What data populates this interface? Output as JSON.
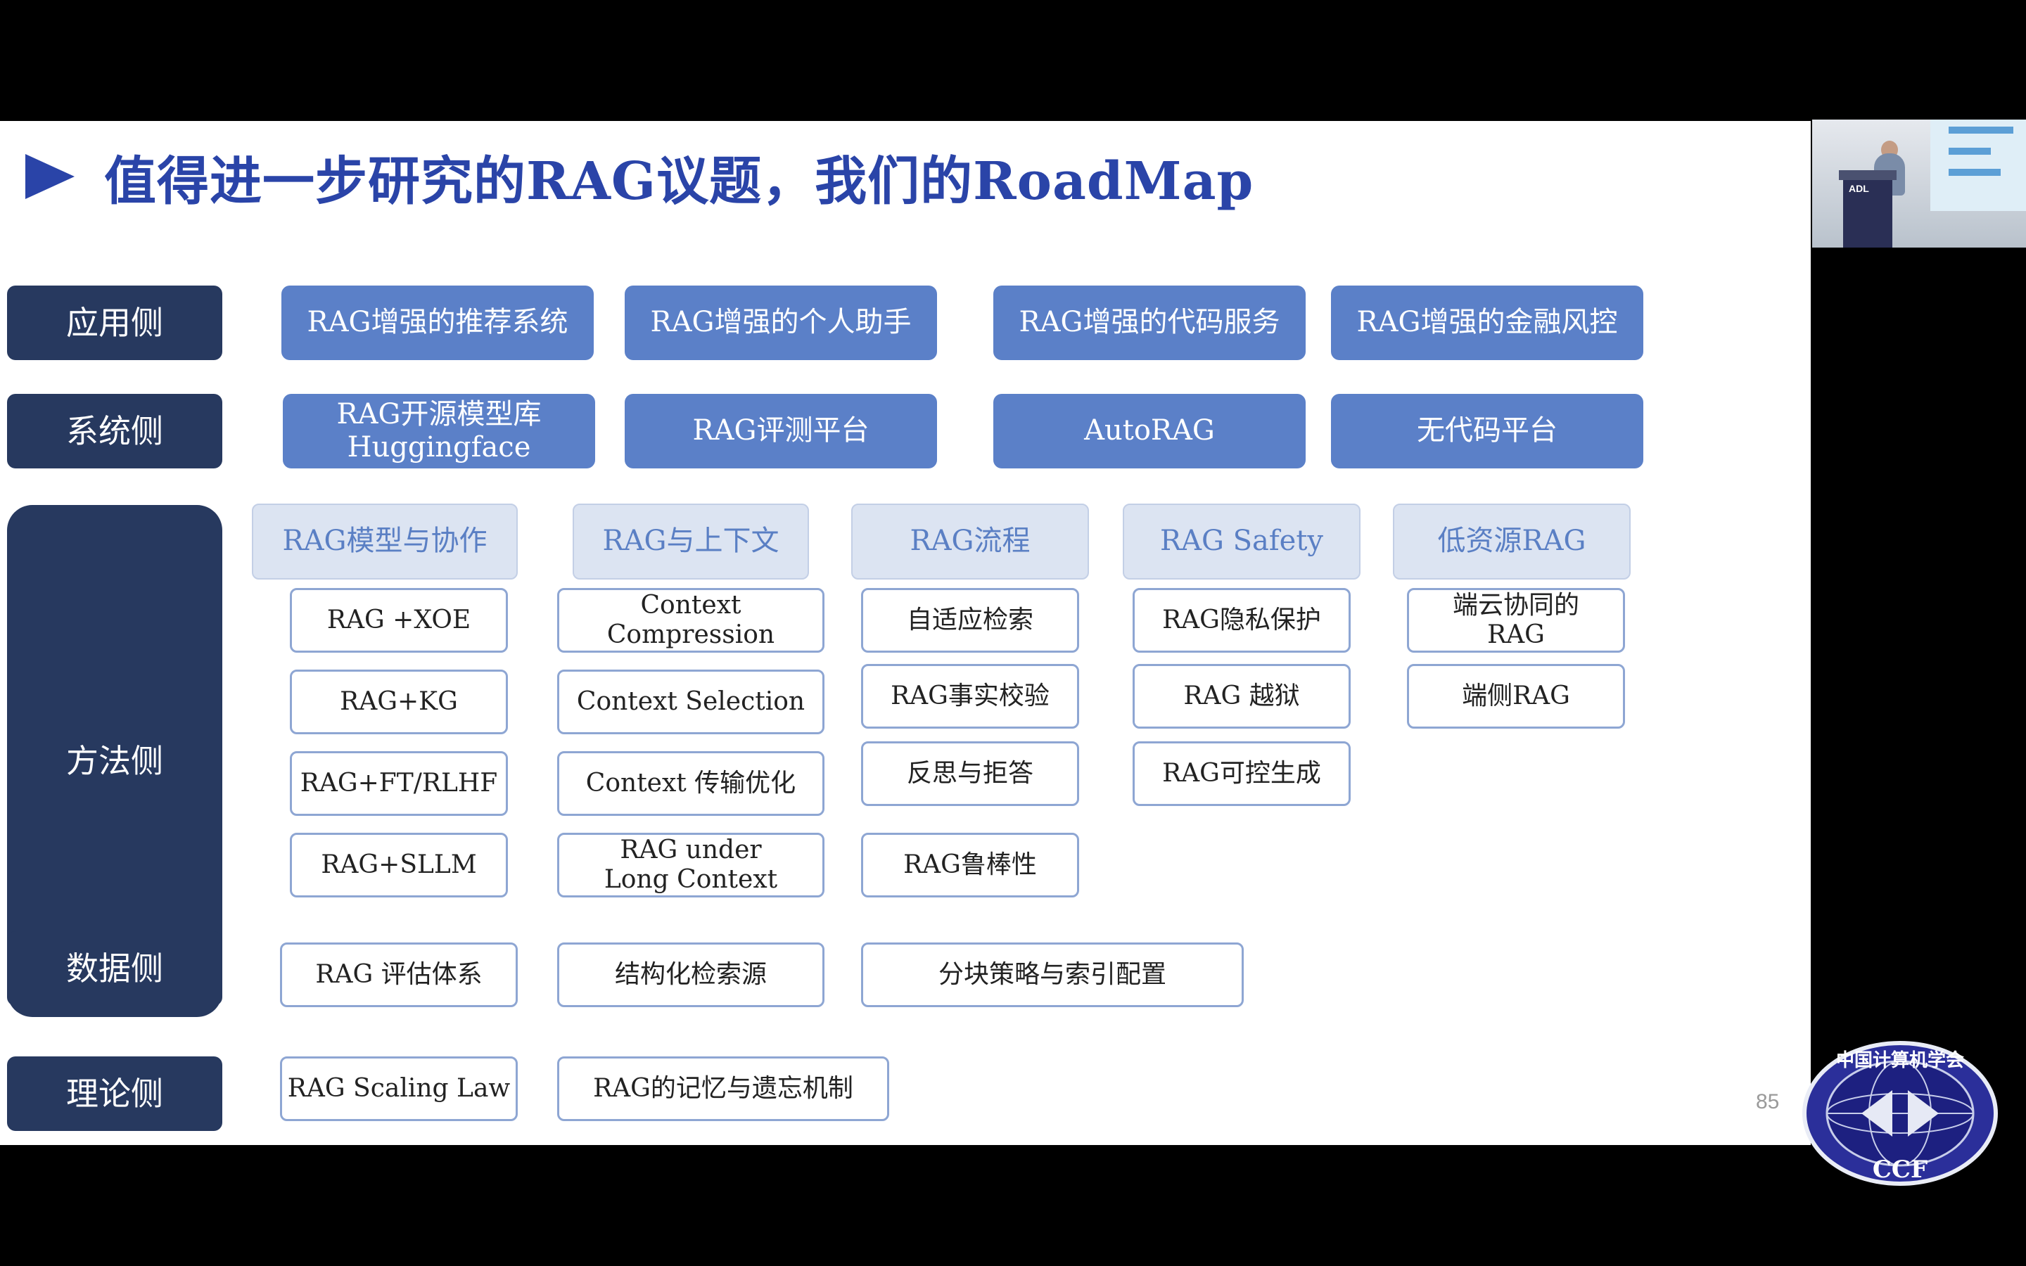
{
  "title": "值得进一步研究的RAG议题，我们的RoadMap",
  "page_number": "85",
  "sides": {
    "app": "应用侧",
    "system": "系统侧",
    "method": "方法侧",
    "data": "数据侧",
    "theory": "理论侧"
  },
  "app_row": [
    "RAG增强的推荐系统",
    "RAG增强的个人助手",
    "RAG增强的代码服务",
    "RAG增强的金融风控"
  ],
  "system_row": {
    "model_lib_line1": "RAG开源模型库",
    "model_lib_line2": "Huggingface",
    "eval_platform": "RAG评测平台",
    "autorag": "AutoRAG",
    "nocode": "无代码平台"
  },
  "method": {
    "categories": [
      "RAG模型与协作",
      "RAG与上下文",
      "RAG流程",
      "RAG Safety",
      "低资源RAG"
    ],
    "col1": [
      "RAG +XOE",
      "RAG+KG",
      "RAG+FT/RLHF",
      "RAG+SLLM"
    ],
    "col2": {
      "item1": "Context Compression",
      "item2": "Context Selection",
      "item3": "Context 传输优化",
      "item4_line1": "RAG under",
      "item4_line2": "Long Context"
    },
    "col3": [
      "自适应检索",
      "RAG事实校验",
      "反思与拒答",
      "RAG鲁棒性"
    ],
    "col4": [
      "RAG隐私保护",
      "RAG 越狱",
      "RAG可控生成"
    ],
    "col5": {
      "item1_line1": "端云协同的",
      "item1_line2": "RAG",
      "item2": "端侧RAG"
    }
  },
  "data_row": [
    "RAG 评估体系",
    "结构化检索源",
    "分块策略与索引配置"
  ],
  "theory_row": [
    "RAG Scaling Law",
    "RAG的记忆与遗忘机制"
  ],
  "video": {
    "podium_label": "ADL"
  },
  "logo": {
    "text": "中国计算机学会",
    "abbr": "CCF"
  },
  "colors": {
    "title": "#2a44a8",
    "side_label_bg": "#27395f",
    "blue_box_bg": "#5b80c8",
    "category_bg": "#dce4f2",
    "category_text": "#5a7fc4",
    "item_border": "#8ea6d3"
  }
}
